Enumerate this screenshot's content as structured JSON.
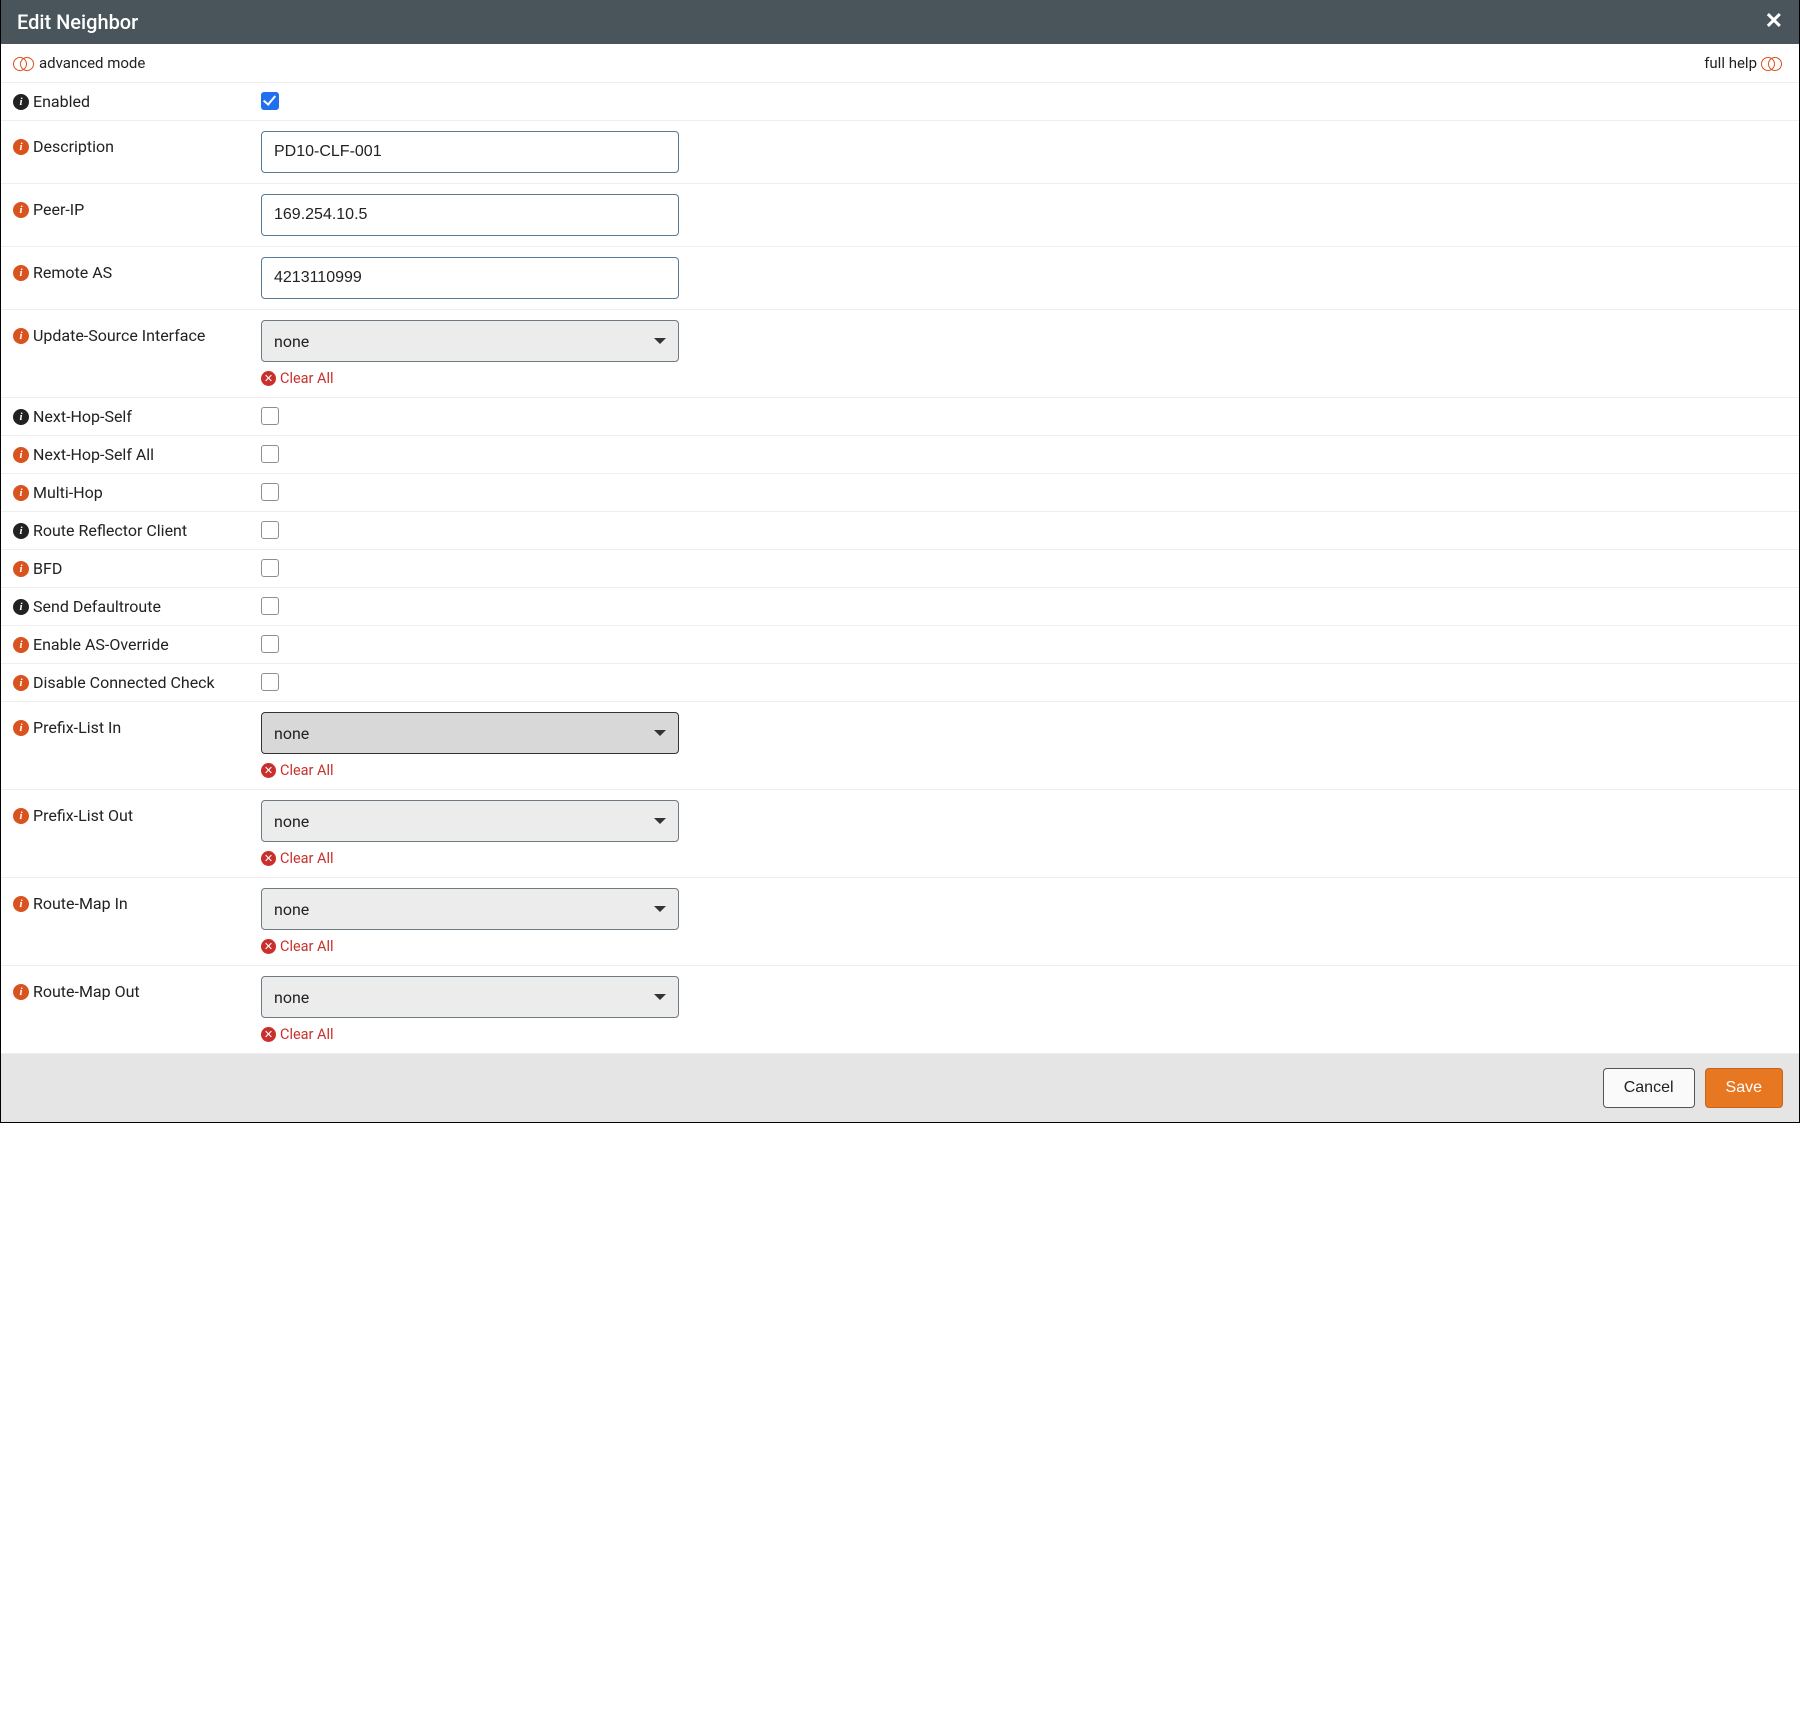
{
  "header": {
    "title": "Edit Neighbor"
  },
  "modeBar": {
    "advanced": "advanced mode",
    "fullHelp": "full help"
  },
  "labels": {
    "enabled": "Enabled",
    "description": "Description",
    "peerIp": "Peer-IP",
    "remoteAs": "Remote AS",
    "updateSource": "Update-Source Interface",
    "nextHopSelf": "Next-Hop-Self",
    "nextHopSelfAll": "Next-Hop-Self All",
    "multiHop": "Multi-Hop",
    "routeReflector": "Route Reflector Client",
    "bfd": "BFD",
    "sendDefault": "Send Defaultroute",
    "asOverride": "Enable AS-Override",
    "disableConnectedCheck": "Disable Connected Check",
    "prefixListIn": "Prefix-List In",
    "prefixListOut": "Prefix-List Out",
    "routeMapIn": "Route-Map In",
    "routeMapOut": "Route-Map Out"
  },
  "values": {
    "enabled": true,
    "description": "PD10-CLF-001",
    "peerIp": "169.254.10.5",
    "remoteAs": "4213110999",
    "updateSource": "none",
    "nextHopSelf": false,
    "nextHopSelfAll": false,
    "multiHop": false,
    "routeReflector": false,
    "bfd": false,
    "sendDefault": false,
    "asOverride": false,
    "disableConnectedCheck": false,
    "prefixListIn": "none",
    "prefixListOut": "none",
    "routeMapIn": "none",
    "routeMapOut": "none"
  },
  "actions": {
    "clearAll": "Clear All",
    "cancel": "Cancel",
    "save": "Save"
  }
}
